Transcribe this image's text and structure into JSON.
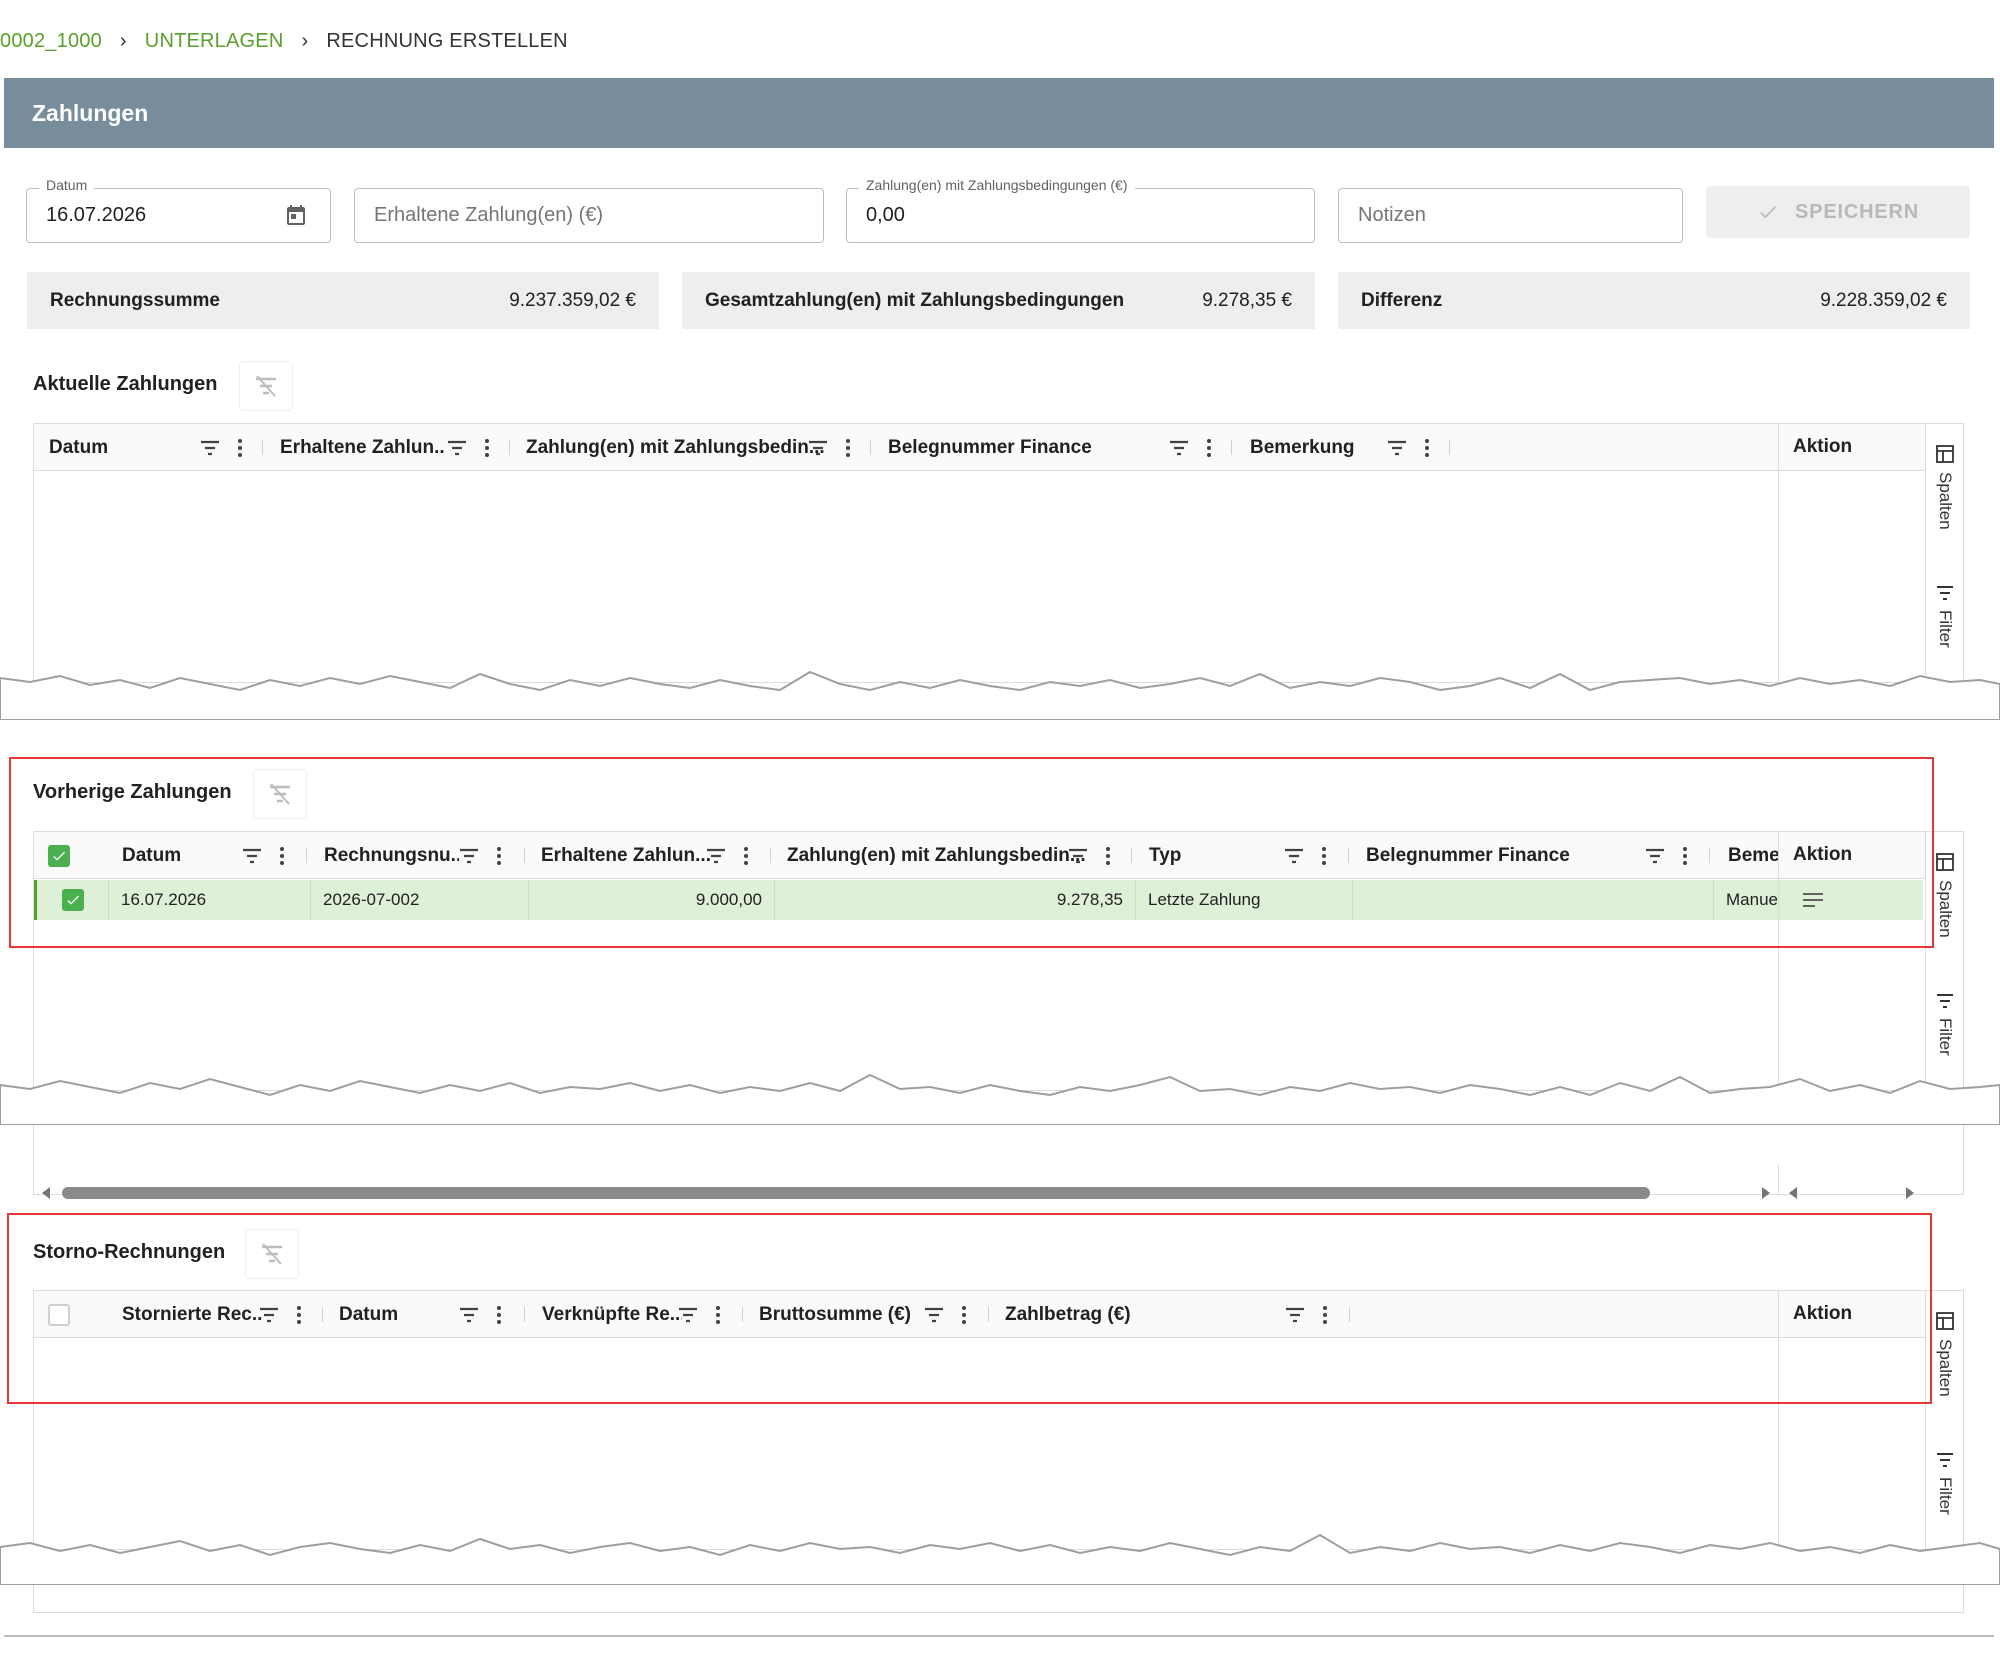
{
  "breadcrumb": {
    "item1": "0002_1000",
    "item2": "UNTERLAGEN",
    "item3": "RECHNUNG ERSTELLEN"
  },
  "panel": {
    "title": "Zahlungen"
  },
  "form": {
    "date_label": "Datum",
    "date_value": "16.07.2026",
    "received_placeholder": "Erhaltene Zahlung(en) (€)",
    "terms_label": "Zahlung(en) mit Zahlungsbedingungen (€)",
    "terms_value": "0,00",
    "notes_placeholder": "Notizen",
    "save_label": "SPEICHERN"
  },
  "summary": {
    "invoice_label": "Rechnungssumme",
    "invoice_value": "9.237.359,02 €",
    "total_label": "Gesamtzahlung(en) mit Zahlungsbedingungen",
    "total_value": "9.278,35 €",
    "diff_label": "Differenz",
    "diff_value": "9.228.359,02 €"
  },
  "current": {
    "title": "Aktuelle Zahlungen",
    "columns": [
      "Datum",
      "Erhaltene Zahlun...",
      "Zahlung(en) mit Zahlungsbedin...",
      "Belegnummer Finance",
      "Bemerkung"
    ],
    "action": "Aktion"
  },
  "previous": {
    "title": "Vorherige Zahlungen",
    "columns": [
      "Datum",
      "Rechnungsnu...",
      "Erhaltene Zahlun...",
      "Zahlung(en) mit Zahlungsbedin...",
      "Typ",
      "Belegnummer Finance",
      "Beme"
    ],
    "action": "Aktion",
    "rows": [
      {
        "date": "16.07.2026",
        "invoice": "2026-07-002",
        "received": "9.000,00",
        "terms": "9.278,35",
        "type": "Letzte Zahlung",
        "finance": "",
        "remark": "Manue"
      }
    ]
  },
  "storno": {
    "title": "Storno-Rechnungen",
    "columns": [
      "Stornierte Rec...",
      "Datum",
      "Verknüpfte Re...",
      "Bruttosumme (€)",
      "Zahlbetrag (€)"
    ],
    "action": "Aktion"
  },
  "side": {
    "columns_label": "Spalten",
    "filter_label": "Filter"
  },
  "colors": {
    "accent": "#5aa02c",
    "header": "#778d9b",
    "selected_row": "#dff0d8",
    "highlight": "#e53935"
  }
}
